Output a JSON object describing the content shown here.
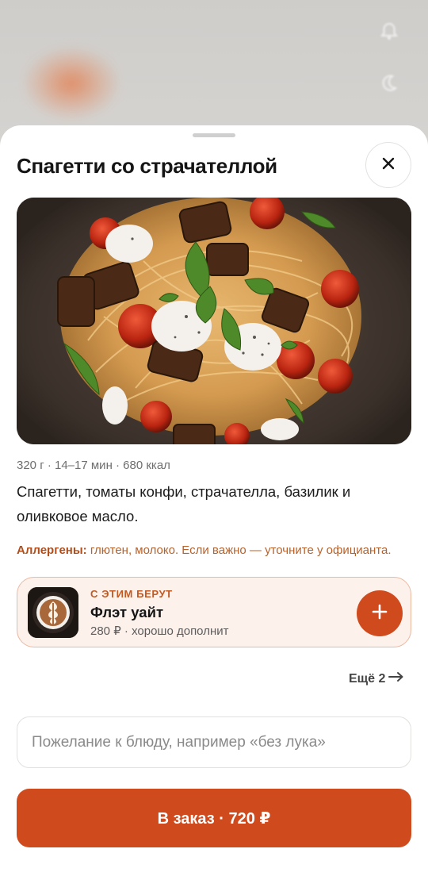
{
  "background": {
    "icons": [
      "bell-icon",
      "moon-icon"
    ]
  },
  "dish": {
    "title": "Спагетти со страчателлой",
    "meta": "320 г · 14–17 мин · 680 ккал",
    "description": "Спагетти, томаты конфи, страчателла, базилик и оливковое масло.",
    "allergens_label": "Аллергены:",
    "allergens_text": " глютен, молоко. Если важно — уточните у официанта.",
    "image_icon": "pasta-photo"
  },
  "pairing": {
    "kicker": "С ЭТИМ БЕРУТ",
    "name": "Флэт уайт",
    "subtitle": "280 ₽ · хорошо дополнит",
    "image_icon": "coffee-photo",
    "add_icon": "plus-icon"
  },
  "more": {
    "label": "Ещё 2",
    "icon": "arrow-right-icon"
  },
  "wish": {
    "value": "",
    "placeholder": "Пожелание к блюду, например «без лука»"
  },
  "order": {
    "label": "В заказ · 720 ₽"
  },
  "colors": {
    "accent": "#cf4b1e",
    "card_bg": "#fdf1ec",
    "card_border": "#eab9a2",
    "allergen": "#b8612b"
  }
}
